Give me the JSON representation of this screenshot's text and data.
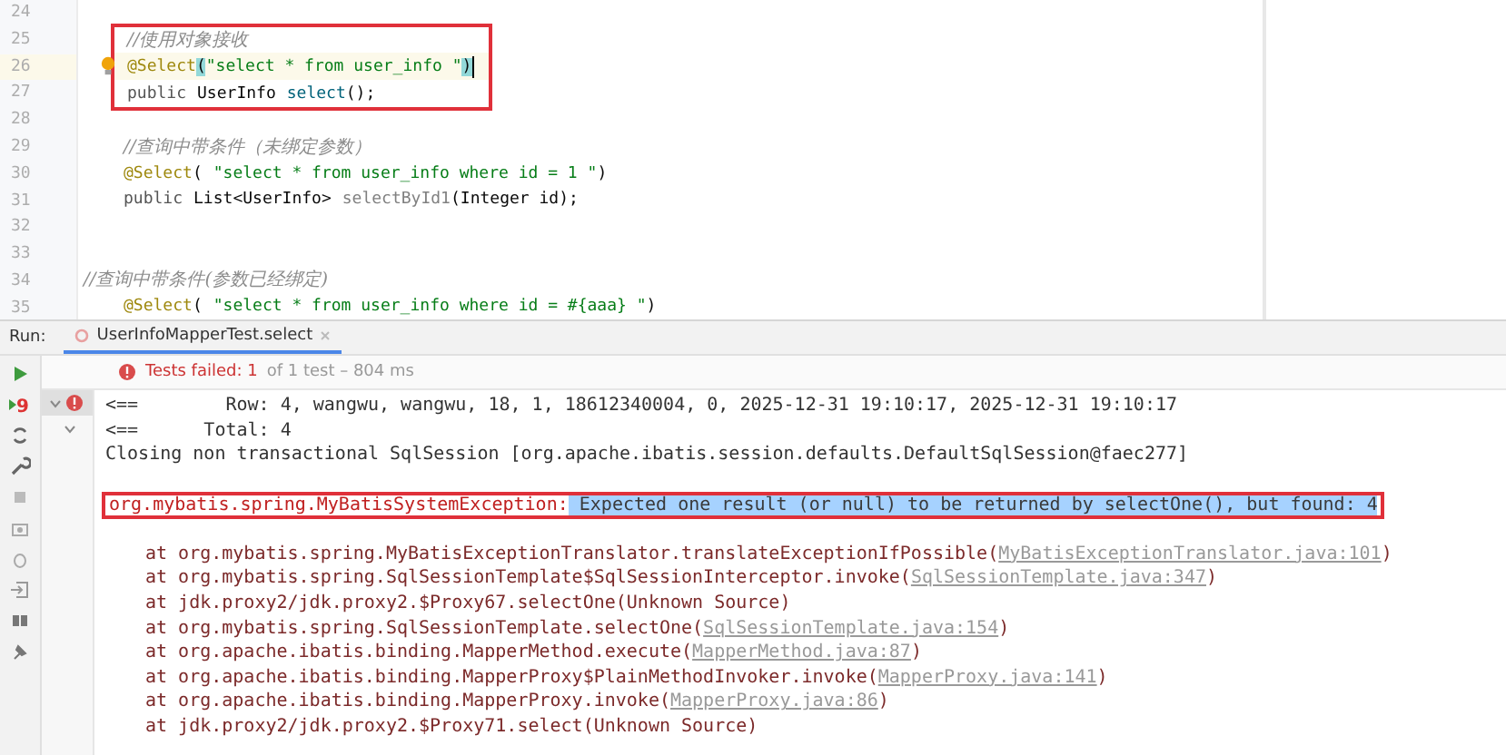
{
  "editor": {
    "lines": [
      {
        "number": "24"
      },
      {
        "number": "25",
        "indented": true,
        "in_red_box": true,
        "segments": [
          {
            "kind": "comment",
            "text": "//使用对象接收"
          }
        ]
      },
      {
        "number": "26",
        "indented": true,
        "in_red_box": true,
        "current": true,
        "bulb": true,
        "segments": [
          {
            "kind": "annotation",
            "text": "@Select"
          },
          {
            "kind": "brace",
            "text": "("
          },
          {
            "kind": "string",
            "text": "\"select * from user_info \""
          },
          {
            "kind": "brace",
            "text": ")"
          }
        ]
      },
      {
        "number": "27",
        "indented": true,
        "in_red_box": true,
        "segments": [
          {
            "kind": "keyword",
            "text": "public"
          },
          {
            "kind": "plain",
            "text": "UserInfo"
          },
          {
            "kind": "method",
            "text": "select"
          },
          {
            "kind": "plain",
            "text": "();"
          }
        ]
      },
      {
        "number": "28"
      },
      {
        "number": "29",
        "indented": true,
        "segments": [
          {
            "kind": "comment",
            "text": "//查询中带条件（未绑定参数）"
          }
        ]
      },
      {
        "number": "30",
        "indented": true,
        "segments": [
          {
            "kind": "annotation",
            "text": "@Select"
          },
          {
            "kind": "plain",
            "text": "("
          },
          {
            "kind": "string",
            "text": "\"select * from user_info where id = 1 \""
          },
          {
            "kind": "plain",
            "text": ")"
          }
        ]
      },
      {
        "number": "31",
        "indented": true,
        "segments": [
          {
            "kind": "keyword",
            "text": "public"
          },
          {
            "kind": "plain",
            "text": "List<UserInfo>"
          },
          {
            "kind": "unused",
            "text": "selectById1"
          },
          {
            "kind": "plain",
            "text": "(Integer id);"
          }
        ]
      },
      {
        "number": "32"
      },
      {
        "number": "33"
      },
      {
        "number": "34",
        "indented": false,
        "segments": [
          {
            "kind": "comment",
            "text": "//查询中带条件(参数已经绑定)"
          }
        ]
      },
      {
        "number": "35",
        "indented": true,
        "segments": [
          {
            "kind": "annotation",
            "text": "@Select"
          },
          {
            "kind": "plain",
            "text": "("
          },
          {
            "kind": "string",
            "text": "\"select * from user_info where id = #{aaa} \""
          },
          {
            "kind": "plain",
            "text": ")"
          }
        ]
      }
    ]
  },
  "run_panel": {
    "label": "Run:",
    "tabs": [
      {
        "label": "UserInfoMapperTest.select",
        "selected": true
      }
    ],
    "status": {
      "failed": "Tests failed: 1",
      "rest": "of 1 test – 804 ms"
    },
    "rerun_badge": "9",
    "console": [
      {
        "kind": "log",
        "text": "<==        Row: 4, wangwu, wangwu, 18, 1, 18612340004, 0, 2025-12-31 19:10:17, 2025-12-31 19:10:17"
      },
      {
        "kind": "log",
        "text": "<==      Total: 4"
      },
      {
        "kind": "log",
        "text": "Closing non transactional SqlSession [org.apache.ibatis.session.defaults.DefaultSqlSession@faec277]"
      },
      {
        "kind": "blank"
      },
      {
        "kind": "exception",
        "class": "org.mybatis.spring.MyBatisSystemException:",
        "message": " Expected one result (or null) to be returned by selectOne(), but found: 4",
        "message_selected": true
      },
      {
        "kind": "blank"
      },
      {
        "kind": "frame",
        "call": "at org.mybatis.spring.MyBatisExceptionTranslator.translateExceptionIfPossible(",
        "link": "MyBatisExceptionTranslator.java:101",
        "close": ")"
      },
      {
        "kind": "frame",
        "call": "at org.mybatis.spring.SqlSessionTemplate$SqlSessionInterceptor.invoke(",
        "link": "SqlSessionTemplate.java:347",
        "close": ")"
      },
      {
        "kind": "frame",
        "call": "at jdk.proxy2/jdk.proxy2.$Proxy67.selectOne(Unknown Source)"
      },
      {
        "kind": "frame",
        "call": "at org.mybatis.spring.SqlSessionTemplate.selectOne(",
        "link": "SqlSessionTemplate.java:154",
        "close": ")"
      },
      {
        "kind": "frame",
        "call": "at org.apache.ibatis.binding.MapperMethod.execute(",
        "link": "MapperMethod.java:87",
        "close": ")"
      },
      {
        "kind": "frame",
        "call": "at org.apache.ibatis.binding.MapperProxy$PlainMethodInvoker.invoke(",
        "link": "MapperProxy.java:141",
        "close": ")"
      },
      {
        "kind": "frame",
        "call": "at org.apache.ibatis.binding.MapperProxy.invoke(",
        "link": "MapperProxy.java:86",
        "close": ")"
      },
      {
        "kind": "frame",
        "call": "at jdk.proxy2/jdk.proxy2.$Proxy71.select(Unknown Source)"
      }
    ]
  }
}
